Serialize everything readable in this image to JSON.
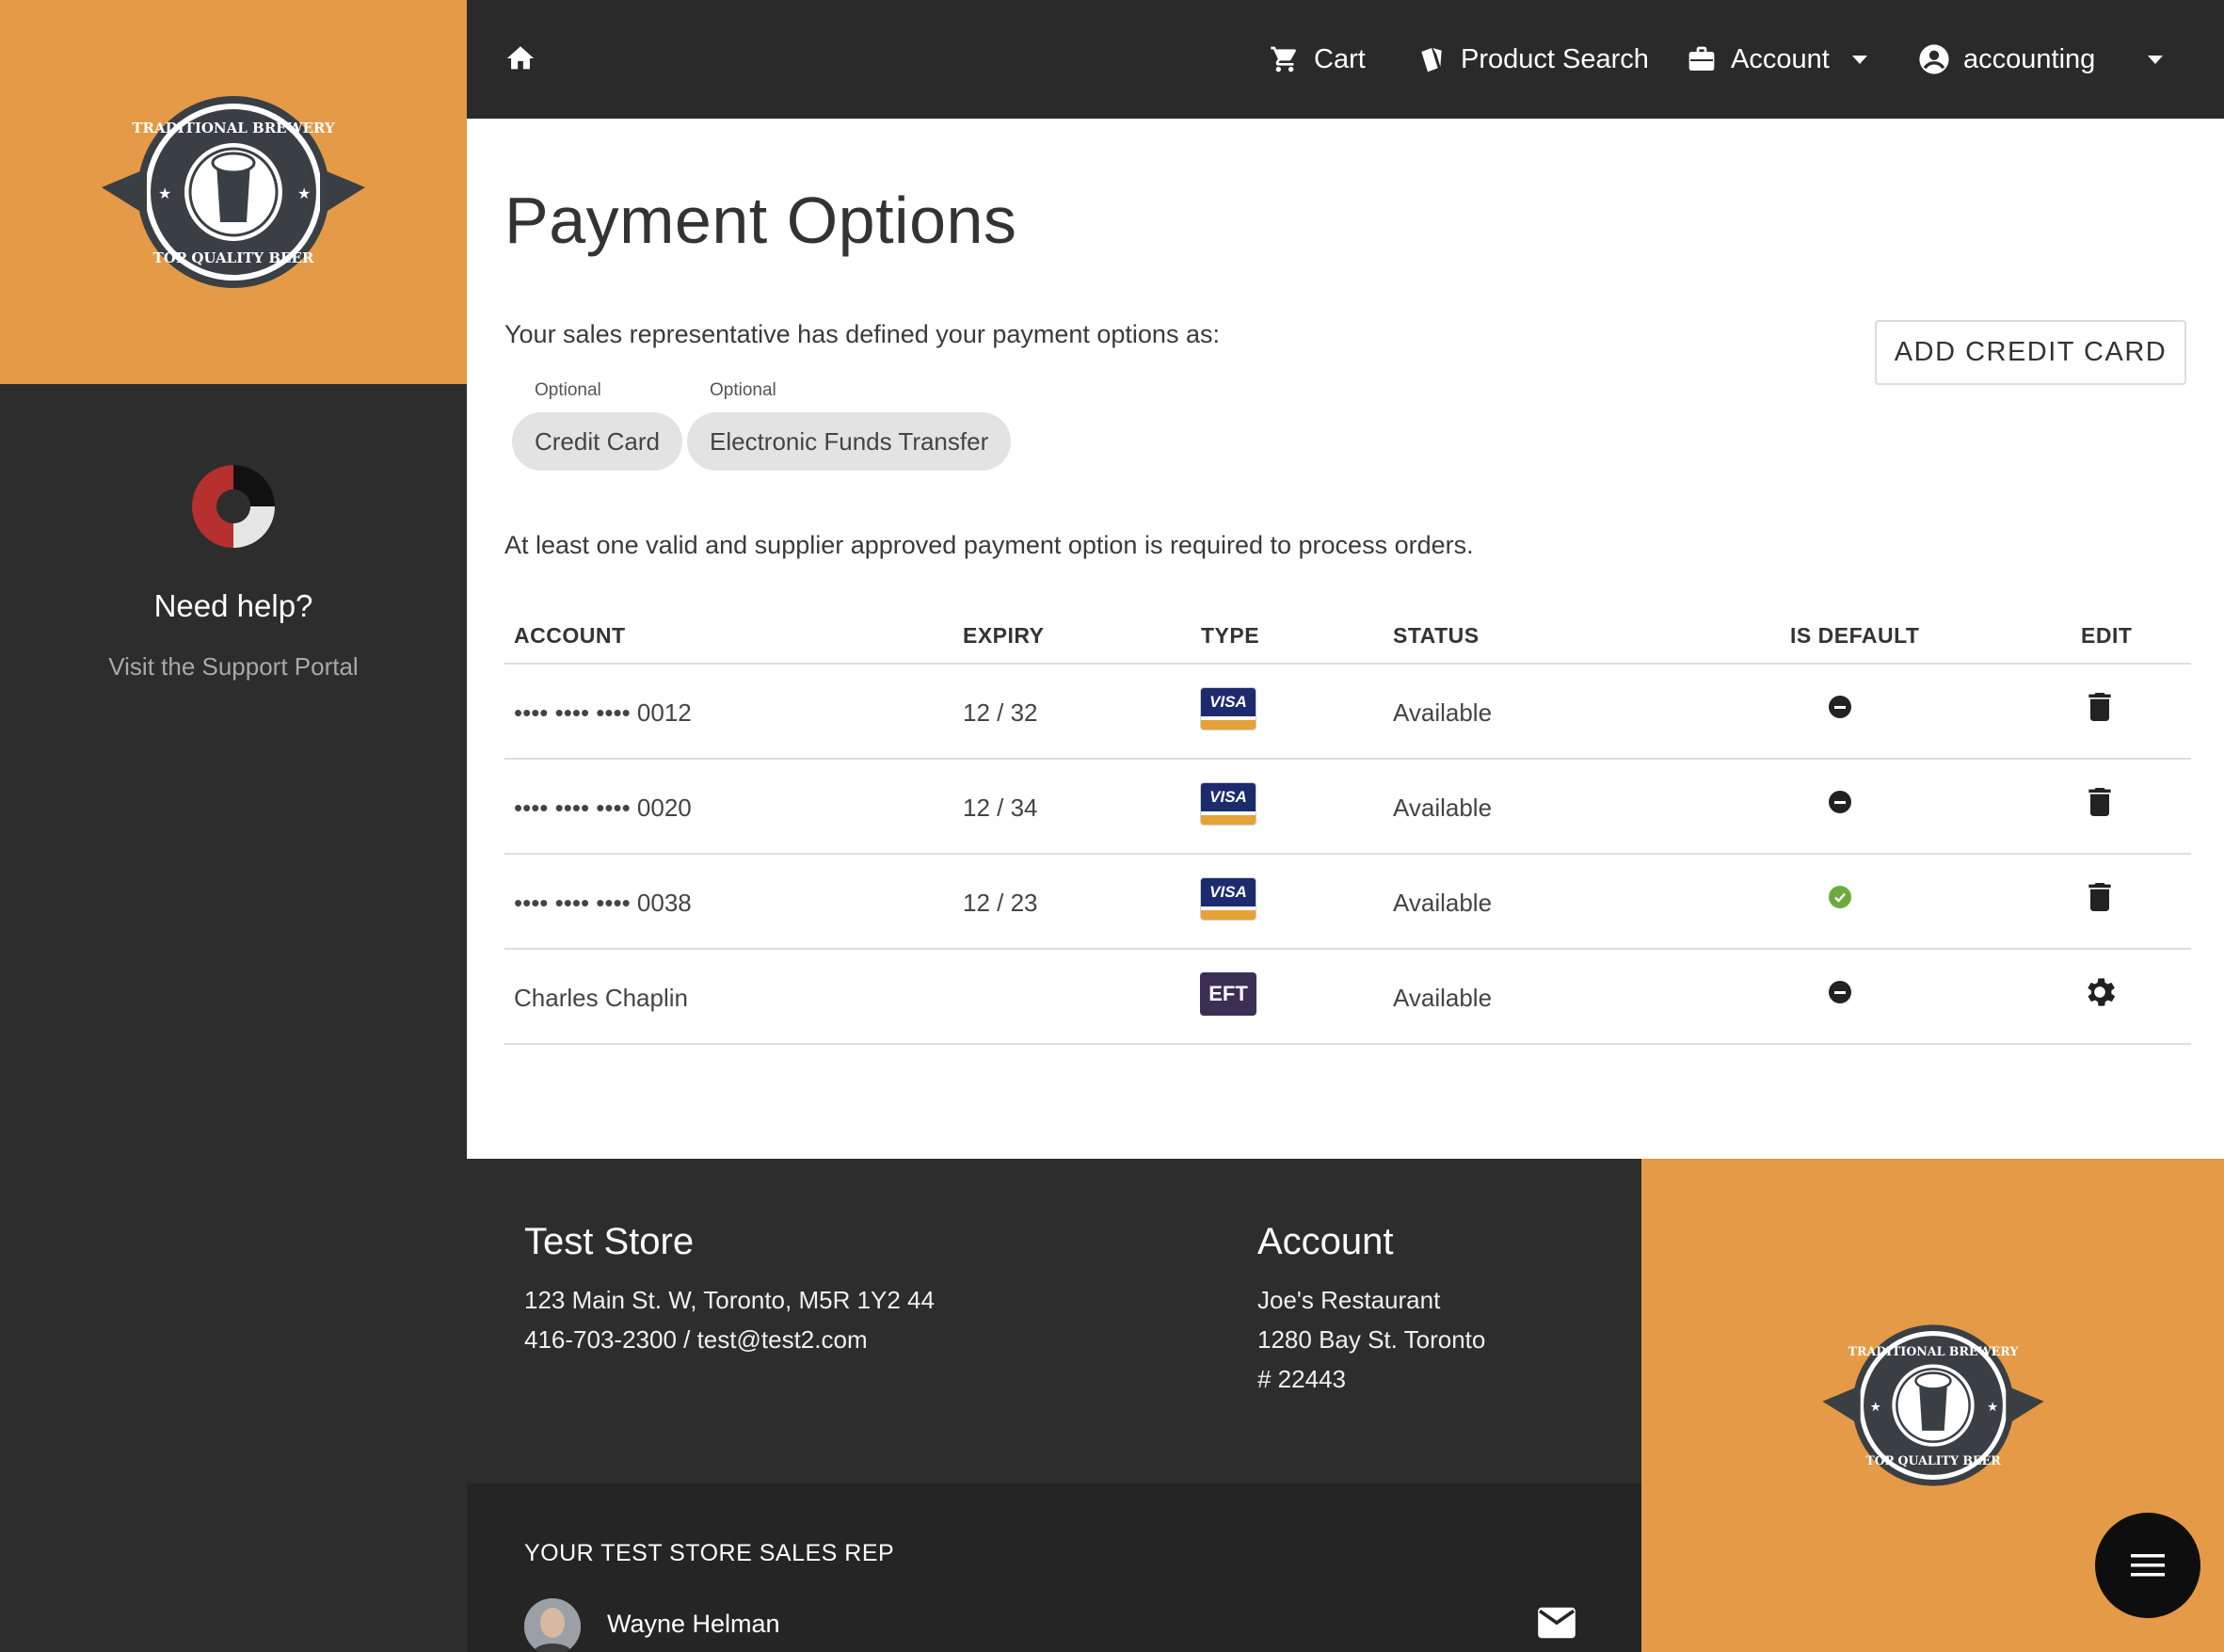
{
  "sidebar": {
    "logo_alt": "Traditional Brewery Top Quality Beer",
    "help_title": "Need help?",
    "help_link": "Visit the Support Portal"
  },
  "nav": {
    "home_icon": "home-icon",
    "cart": "Cart",
    "product_search": "Product Search",
    "account": "Account",
    "user": "accounting"
  },
  "page": {
    "title": "Payment Options",
    "intro": "Your sales representative has defined your payment options as:",
    "add_button": "ADD CREDIT CARD",
    "chips": [
      {
        "caption": "Optional",
        "label": "Credit Card"
      },
      {
        "caption": "Optional",
        "label": "Electronic Funds Transfer"
      }
    ],
    "notice": "At least one valid and supplier approved payment option is required to process orders."
  },
  "table": {
    "headers": {
      "account": "ACCOUNT",
      "expiry": "EXPIRY",
      "type": "TYPE",
      "status": "STATUS",
      "is_default": "IS DEFAULT",
      "edit": "EDIT"
    },
    "rows": [
      {
        "account": "•••• •••• •••• 0012",
        "expiry": "12 / 32",
        "type": "VISA",
        "status": "Available",
        "is_default": false,
        "edit_icon": "trash-icon"
      },
      {
        "account": "•••• •••• •••• 0020",
        "expiry": "12 / 34",
        "type": "VISA",
        "status": "Available",
        "is_default": false,
        "edit_icon": "trash-icon"
      },
      {
        "account": "•••• •••• •••• 0038",
        "expiry": "12 / 23",
        "type": "VISA",
        "status": "Available",
        "is_default": true,
        "edit_icon": "trash-icon"
      },
      {
        "account": "Charles Chaplin",
        "expiry": "",
        "type": "EFT",
        "status": "Available",
        "is_default": false,
        "edit_icon": "gear-icon"
      }
    ]
  },
  "footer": {
    "store": {
      "title": "Test Store",
      "address": "123 Main St. W, Toronto, M5R 1Y2 44",
      "contact": "416-703-2300 / test@test2.com"
    },
    "account": {
      "title": "Account",
      "name": "Joe's Restaurant",
      "address": "1280 Bay St. Toronto",
      "number": "# 22443"
    },
    "rep": {
      "title": "YOUR TEST STORE SALES REP",
      "name": "Wayne Helman"
    }
  },
  "colors": {
    "brand_orange": "#e49a46",
    "dark_bg": "#2d2d2d",
    "nav_bg": "#2a2a2a",
    "visa_blue": "#1c2a6e",
    "eft_purple": "#3b2f55",
    "default_green": "#6bab3e"
  }
}
